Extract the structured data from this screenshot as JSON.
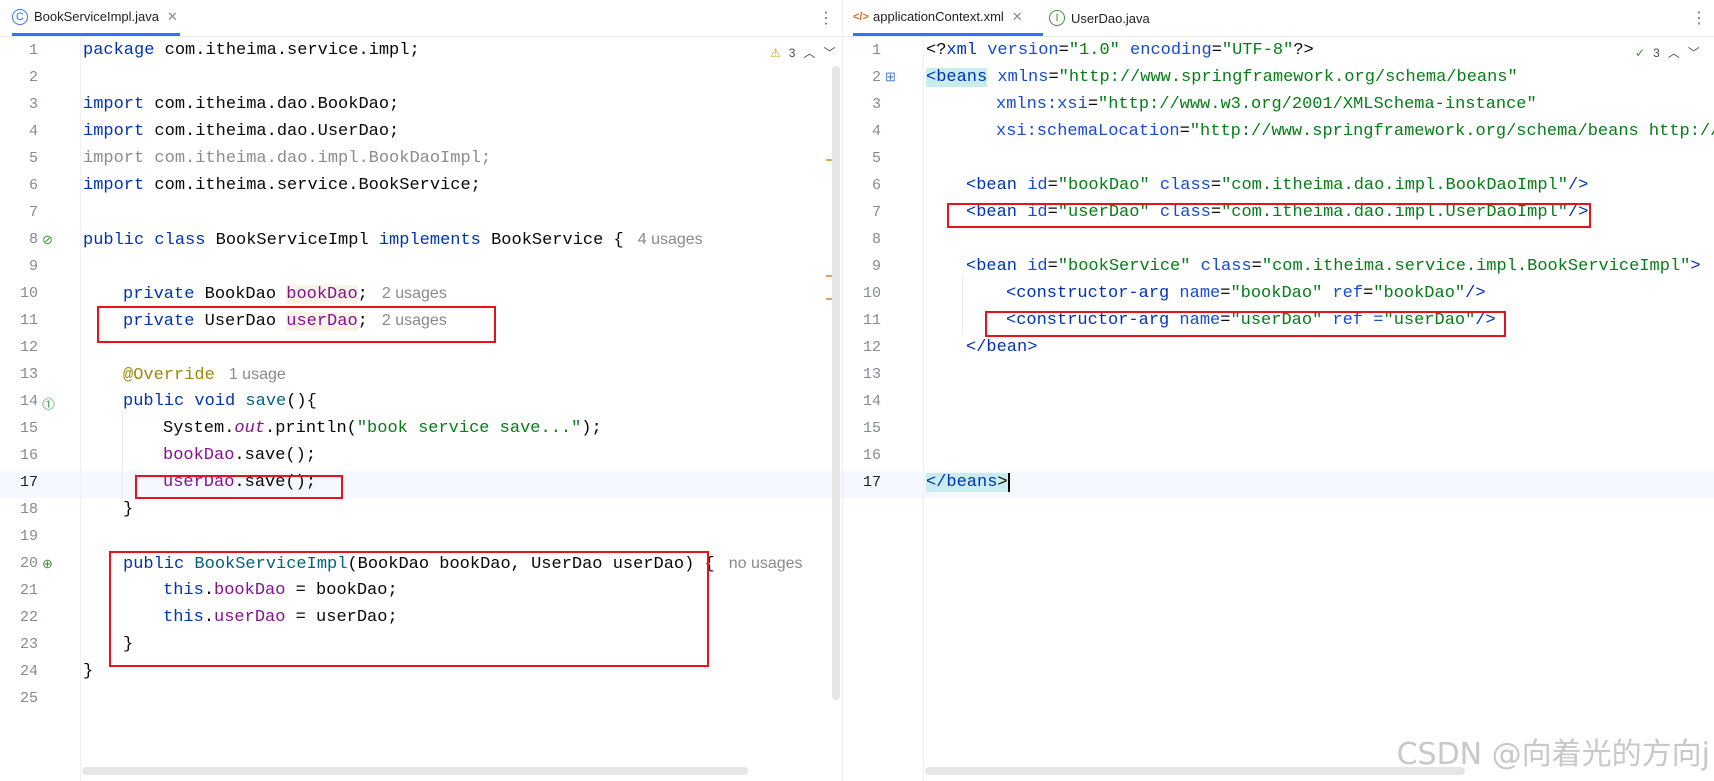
{
  "left": {
    "tab": {
      "label": "BookServiceImpl.java",
      "icon": "class-icon"
    },
    "inspections": "⚠3 ^ ˅",
    "line_numbers": [
      "1",
      "2",
      "3",
      "4",
      "5",
      "6",
      "7",
      "8",
      "9",
      "10",
      "11",
      "12",
      "13",
      "14",
      "15",
      "16",
      "17",
      "18",
      "19",
      "20",
      "21",
      "22",
      "23",
      "24",
      "25"
    ],
    "lines": {
      "l1a": "package",
      "l1b": " com.itheima.service.impl;",
      "l3a": "import",
      "l3b": " com.itheima.dao.BookDao;",
      "l4a": "import",
      "l4b": " com.itheima.dao.UserDao;",
      "l5": "import com.itheima.dao.impl.BookDaoImpl;",
      "l6a": "import",
      "l6b": " com.itheima.service.BookService;",
      "l8a": "public class",
      "l8b": " BookServiceImpl ",
      "l8c": "implements",
      "l8d": " BookService {",
      "l8hint": "4 usages",
      "l10a": "private",
      "l10b": " BookDao ",
      "l10c": "bookDao",
      "l10d": ";",
      "l10hint": "2 usages",
      "l11a": "private",
      "l11b": " UserDao ",
      "l11c": "userDao",
      "l11d": ";",
      "l11hint": "2 usages",
      "l13a": "@Override",
      "l13hint": "1 usage",
      "l14a": "public void",
      "l14b": " save",
      "l14c": "(){",
      "l15a": "System.",
      "l15b": "out",
      "l15c": ".println(",
      "l15d": "\"book service save...\"",
      "l15e": ");",
      "l16a": "bookDao",
      "l16b": ".save();",
      "l17a": "userDao",
      "l17b": ".save();",
      "l18": "}",
      "l20a": "public",
      "l20b": " BookServiceImpl",
      "l20c": "(BookDao bookDao, UserDao userDao) {",
      "l20hint": "no usages",
      "l21a": "this",
      "l21b": ".",
      "l21c": "bookDao",
      "l21d": " = bookDao;",
      "l22a": "this",
      "l22b": ".",
      "l22c": "userDao",
      "l22d": " = userDao;",
      "l23": "}",
      "l24": "}"
    }
  },
  "right": {
    "tabs": [
      {
        "label": "applicationContext.xml",
        "icon": "xml-icon"
      },
      {
        "label": "UserDao.java",
        "icon": "interface-icon"
      }
    ],
    "inspections": "✓3 ^ ˅",
    "line_numbers": [
      "1",
      "2",
      "3",
      "4",
      "5",
      "6",
      "7",
      "8",
      "9",
      "10",
      "11",
      "12",
      "13",
      "14",
      "15",
      "16",
      "17"
    ],
    "lines": {
      "r1a": "<?",
      "r1b": "xml",
      "r1c": " version",
      "r1d": "=",
      "r1e": "\"1.0\"",
      "r1f": " encoding",
      "r1g": "=",
      "r1h": "\"UTF-8\"",
      "r1i": "?>",
      "r2a": "<beans",
      "r2b": " xmlns",
      "r2c": "=",
      "r2d": "\"http://www.springframework.org/schema/beans\"",
      "r3a": "xmlns:xsi",
      "r3b": "=",
      "r3c": "\"http://www.w3.org/2001/XMLSchema-instance\"",
      "r4a": "xsi:schemaLocation",
      "r4b": "=",
      "r4c": "\"http://www.springframework.org/schema/beans http://w",
      "r6a": "<bean",
      "r6b": " id",
      "r6c": "=",
      "r6d": "\"bookDao\"",
      "r6e": " class",
      "r6f": "=",
      "r6g": "\"com.itheima.dao.impl.BookDaoImpl\"",
      "r6h": "/>",
      "r7a": "<bean",
      "r7b": " id",
      "r7c": "=",
      "r7d": "\"userDao\"",
      "r7e": " class",
      "r7f": "=",
      "r7g": "\"com.itheima.dao.impl.UserDaoImpl\"",
      "r7h": "/>",
      "r9a": "<bean",
      "r9b": " id",
      "r9c": "=",
      "r9d": "\"bookService\"",
      "r9e": " class",
      "r9f": "=",
      "r9g": "\"com.itheima.service.impl.BookServiceImpl\"",
      "r9h": ">",
      "r10a": "<constructor-arg",
      "r10b": " name",
      "r10c": "=",
      "r10d": "\"bookDao\"",
      "r10e": " ref",
      "r10f": "=",
      "r10g": "\"bookDao\"",
      "r10h": "/>",
      "r11a": "<constructor-arg",
      "r11b": " name",
      "r11c": "=",
      "r11d": "\"userDao\"",
      "r11e": " ref =",
      "r11g": "\"userDao\"",
      "r11h": "/>",
      "r12": "</bean>",
      "r17a": "</beans",
      "r17b": ">"
    }
  },
  "watermark": "CSDN @向着光的方向j",
  "colors": {
    "keyword": "#0033b3",
    "field": "#871094",
    "string": "#067d17",
    "annotation": "#9e880d",
    "highlight_box": "#e8121b"
  }
}
